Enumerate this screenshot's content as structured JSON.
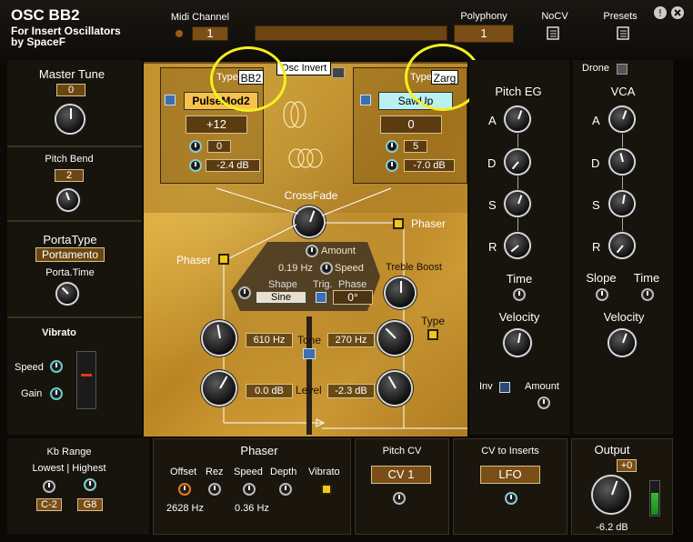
{
  "header": {
    "title": "OSC BB2",
    "subtitle_line1": "For Insert Oscillators",
    "subtitle_line2": "by SpaceF",
    "midi_channel_label": "Midi Channel",
    "midi_channel_value": "1",
    "polyphony_label": "Polyphony",
    "polyphony_value": "1",
    "nocv_label": "NoCV",
    "presets_label": "Presets"
  },
  "left": {
    "master_tune_label": "Master Tune",
    "master_tune_value": "0",
    "pitch_bend_label": "Pitch Bend",
    "pitch_bend_value": "2",
    "porta_type_label": "PortaType",
    "porta_type_value": "Portamento",
    "porta_time_label": "Porta.Time",
    "vibrato_label": "Vibrato",
    "speed_label": "Speed",
    "gain_label": "Gain"
  },
  "osc1": {
    "type_label": "Type",
    "type_value": "BB2",
    "name": "PulseMod2",
    "semitone": "+12",
    "detune": "0",
    "level": "-2.4 dB"
  },
  "osc2": {
    "type_label": "Type",
    "type_value": "Zarg",
    "name": "SawUp",
    "semitone": "0",
    "detune": "5",
    "level": "-7.0 dB"
  },
  "tooltip": "Osc Invert",
  "mixer": {
    "crossfade_label": "CrossFade",
    "phaser_right_label": "Phaser",
    "phaser_left_label": "Phaser",
    "amount_label": "Amount",
    "speed_value": "0.19 Hz",
    "speed_label": "Speed",
    "shape_label": "Shape",
    "shape_value": "Sine",
    "trig_label": "Trig.",
    "phase_label": "Phase",
    "phase_value": "0°",
    "treble_boost_label": "Treble Boost",
    "type_label": "Type",
    "tone_label": "Tone",
    "tone_left_value": "610 Hz",
    "tone_right_value": "270 Hz",
    "level_label": "Level",
    "level_left_value": "0.0 dB",
    "level_right_value": "-2.3 dB"
  },
  "pitch_eg": {
    "title": "Pitch EG",
    "a": "A",
    "d": "D",
    "s": "S",
    "r": "R",
    "time_label": "Time",
    "velocity_label": "Velocity",
    "inv_label": "Inv",
    "amount_label": "Amount"
  },
  "vca": {
    "drone_label": "Drone",
    "title": "VCA",
    "a": "A",
    "d": "D",
    "s": "S",
    "r": "R",
    "slope_label": "Slope",
    "time_label": "Time",
    "velocity_label": "Velocity"
  },
  "bottom": {
    "kb_range_label": "Kb Range",
    "lowest_highest_label": "Lowest | Highest",
    "lowest_value": "C-2",
    "highest_value": "G8",
    "phaser_title": "Phaser",
    "offset_label": "Offset",
    "rez_label": "Rez",
    "speed_label": "Speed",
    "depth_label": "Depth",
    "vibrato_label": "Vibrato",
    "offset_value": "2628 Hz",
    "speed_value": "0.36 Hz",
    "pitch_cv_label": "Pitch CV",
    "pitch_cv_value": "CV 1",
    "cv_to_inserts_label": "CV to Inserts",
    "cv_to_inserts_value": "LFO",
    "output_label": "Output",
    "output_trim": "+0",
    "output_value": "-6.2 dB"
  },
  "colors": {
    "gold": "#d2a034",
    "field_brown": "#5b3c10",
    "highlight_circle": "#f4f01e",
    "osc1_button": "#f7c24a",
    "osc2_button": "#b9f0f0"
  }
}
